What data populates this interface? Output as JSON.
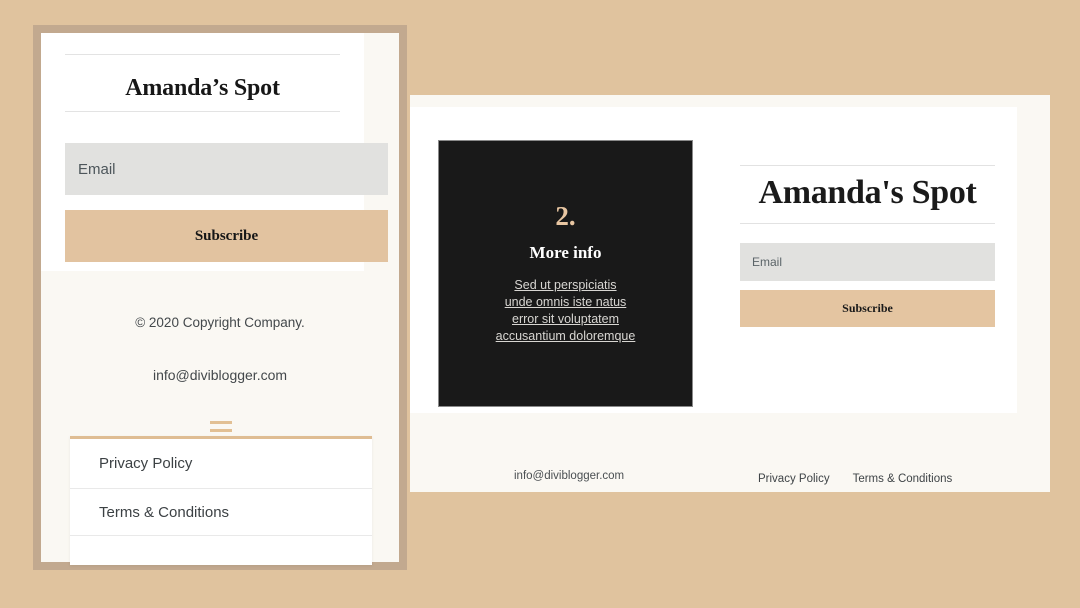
{
  "theme": {
    "page_background": "#e0c39e",
    "frame_border": "#c2a98f",
    "cream": "#faf8f3",
    "accent_tan": "#e2c3a0",
    "dark_panel": "#191919",
    "input_gray": "#e1e1df"
  },
  "desktop_preview": {
    "dark_panel": {
      "number": "2.",
      "heading": "More info",
      "links": [
        "Sed ut perspiciatis",
        "unde omnis iste natus",
        "error sit voluptatem",
        "accusantium doloremque"
      ]
    },
    "signup": {
      "title": "Amanda's Spot",
      "email_placeholder": "Email",
      "subscribe_label": "Subscribe"
    },
    "footer": {
      "email": "info@diviblogger.com",
      "links": [
        "Privacy Policy",
        "Terms & Conditions"
      ]
    }
  },
  "mobile_preview": {
    "title": "Amanda’s Spot",
    "email_placeholder": "Email",
    "subscribe_label": "Subscribe",
    "copyright": "© 2020 Copyright Company.",
    "email": "info@diviblogger.com",
    "menu_icon": "hamburger-menu-icon",
    "dropdown_items": [
      "Privacy Policy",
      "Terms & Conditions"
    ]
  }
}
